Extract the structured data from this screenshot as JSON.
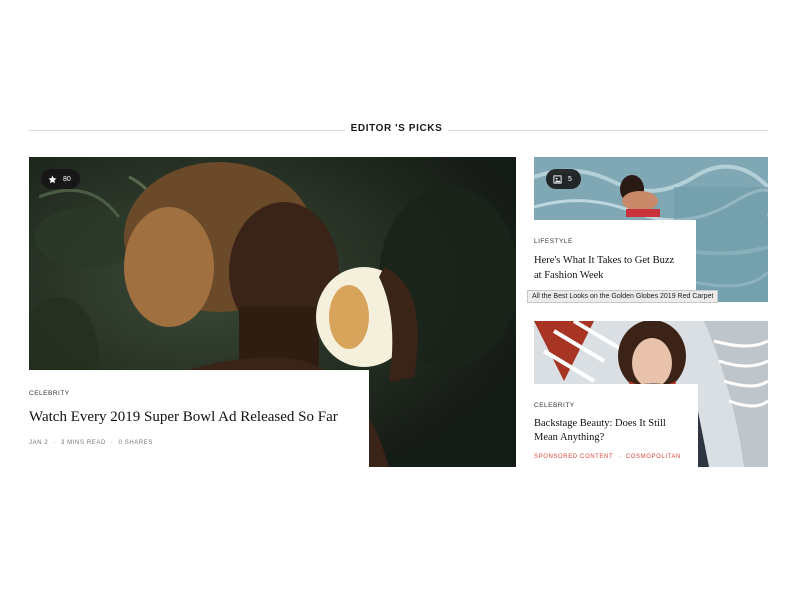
{
  "section": {
    "title": "EDITOR 'S PICKS"
  },
  "featured": {
    "badge_icon": "star-icon",
    "badge_count": "80",
    "category": "CELEBRITY",
    "headline": "Watch Every 2019 Super Bowl Ad Released So Far",
    "meta": {
      "date": "JAN 2",
      "read_time": "3 MINS READ",
      "shares": "0 SHARES"
    }
  },
  "side_top": {
    "badge_icon": "gallery-icon",
    "badge_count": "5",
    "category": "LIFESTYLE",
    "headline": "Here's What It Takes to Get Buzz at Fashion Week",
    "tooltip": "All the Best Looks on the Golden Globes 2019 Red Carpet"
  },
  "side_bottom": {
    "category": "CELEBRITY",
    "headline": "Backstage Beauty: Does It Still Mean Anything?",
    "meta": {
      "sponsor": "SPONSORED CONTENT",
      "publisher": "COSMOPOLITAN"
    },
    "accent_color": "#e0463a"
  }
}
